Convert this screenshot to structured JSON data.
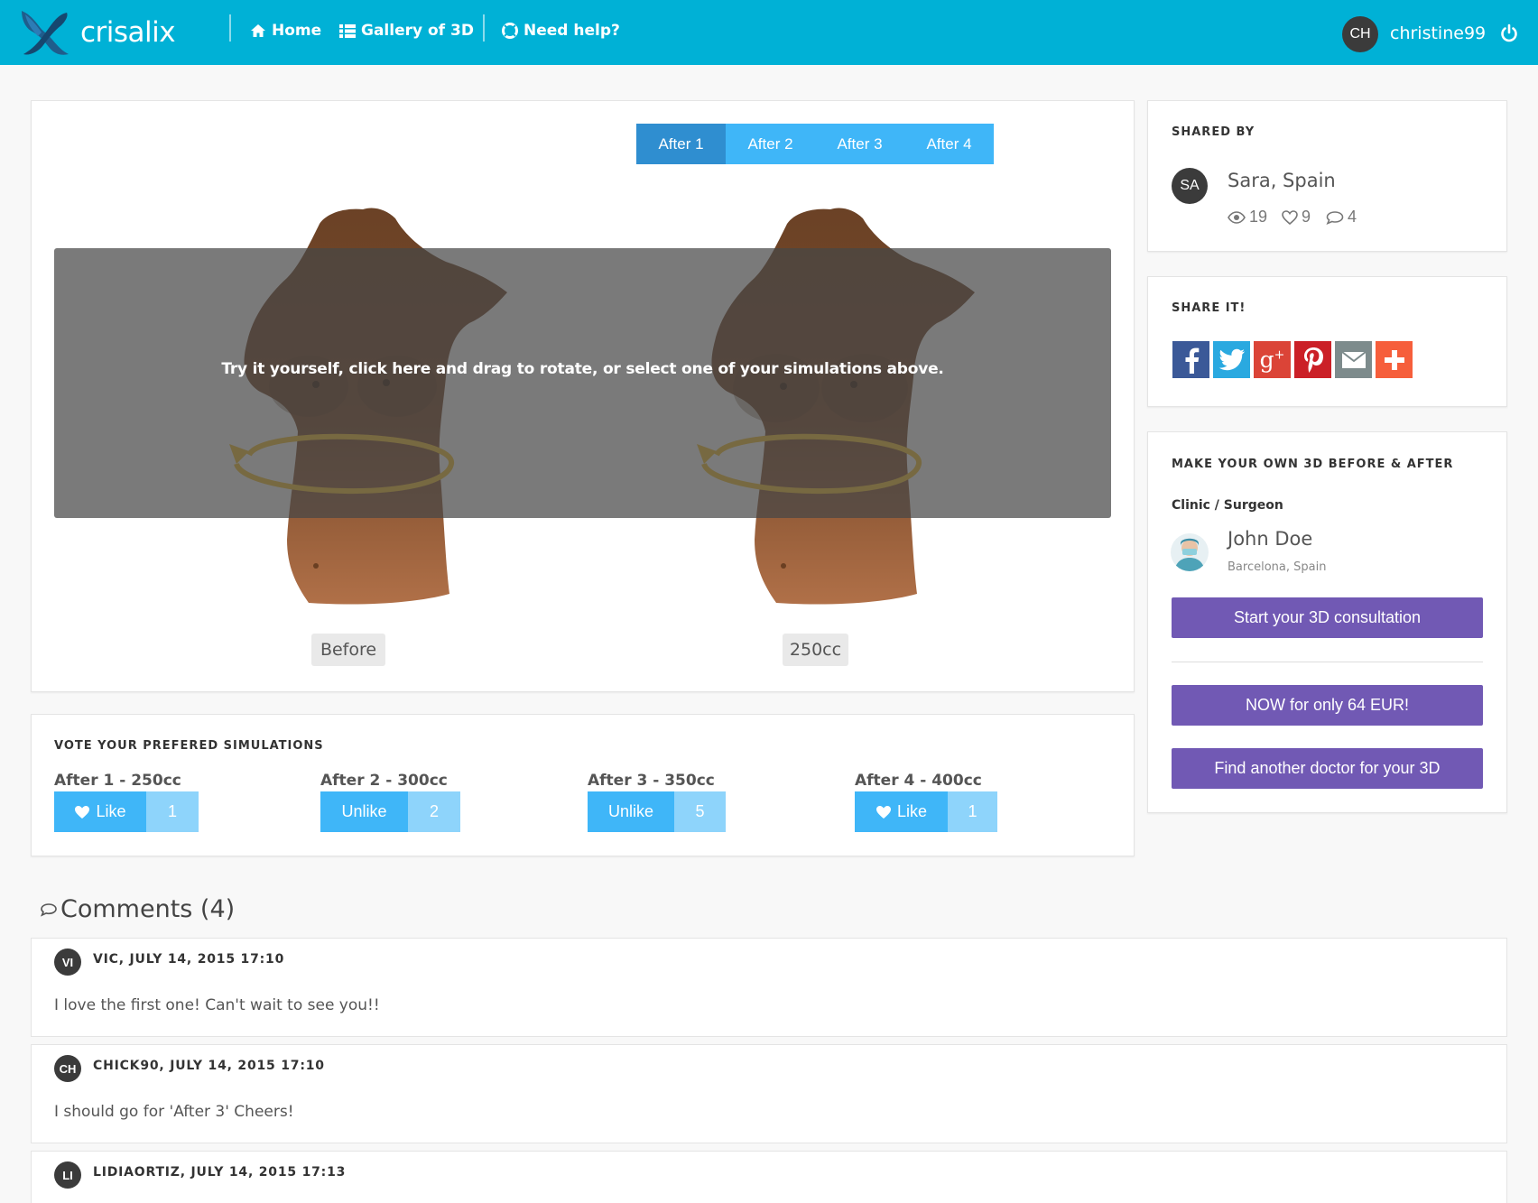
{
  "header": {
    "logo_text": "crisalix",
    "nav": [
      {
        "label": "Home",
        "icon": "home-icon"
      },
      {
        "label": "Gallery of 3D",
        "icon": "grid-icon"
      },
      {
        "label": "Need help?",
        "icon": "lifebuoy-icon"
      }
    ],
    "user": {
      "initials": "CH",
      "name": "christine99"
    },
    "colors": {
      "bar": "#00b1d6"
    }
  },
  "viewer": {
    "tabs": [
      {
        "label": "After 1",
        "active": true
      },
      {
        "label": "After 2",
        "active": false
      },
      {
        "label": "After 3",
        "active": false
      },
      {
        "label": "After 4",
        "active": false
      }
    ],
    "overlay_text": "Try it yourself, click here and drag to rotate, or select one of your simulations above.",
    "before_label": "Before",
    "after_label": "250cc"
  },
  "vote": {
    "title": "VOTE YOUR PREFERED SIMULATIONS",
    "items": [
      {
        "label": "After 1 - 250cc",
        "action": "Like",
        "count": "1"
      },
      {
        "label": "After 2 - 300cc",
        "action": "Unlike",
        "count": "2"
      },
      {
        "label": "After 3 - 350cc",
        "action": "Unlike",
        "count": "5"
      },
      {
        "label": "After 4 - 400cc",
        "action": "Like",
        "count": "1"
      }
    ]
  },
  "shared_by": {
    "title": "SHARED BY",
    "initials": "SA",
    "name": "Sara, Spain",
    "views": "19",
    "likes": "9",
    "comments": "4"
  },
  "share": {
    "title": "SHARE IT!",
    "icons": [
      {
        "name": "facebook-icon",
        "color": "#3b5998"
      },
      {
        "name": "twitter-icon",
        "color": "#2aa9e0"
      },
      {
        "name": "google-plus-icon",
        "color": "#db4437"
      },
      {
        "name": "pinterest-icon",
        "color": "#cb2027"
      },
      {
        "name": "email-icon",
        "color": "#7d8b8c"
      },
      {
        "name": "add-more-icon",
        "color": "#f65e3b"
      }
    ]
  },
  "make_own": {
    "title": "MAKE YOUR OWN 3D BEFORE & AFTER",
    "subtitle": "Clinic / Surgeon",
    "doctor_name": "John Doe",
    "doctor_location": "Barcelona, Spain",
    "start_btn": "Start your 3D consultation",
    "price_btn": "NOW for only 64 EUR!",
    "find_btn": "Find another doctor for your 3D",
    "button_color": "#7159b4"
  },
  "comments": {
    "title": "Comments (4)",
    "items": [
      {
        "initials": "VI",
        "header": "VIC, JULY 14, 2015 17:10",
        "text": "I love the first one! Can't wait to see you!!"
      },
      {
        "initials": "CH",
        "header": "CHICK90, JULY 14, 2015 17:10",
        "text": "I should go for 'After 3' Cheers!"
      },
      {
        "initials": "LI",
        "header": "LIDIAORTIZ, JULY 14, 2015 17:13",
        "text": ""
      }
    ]
  }
}
